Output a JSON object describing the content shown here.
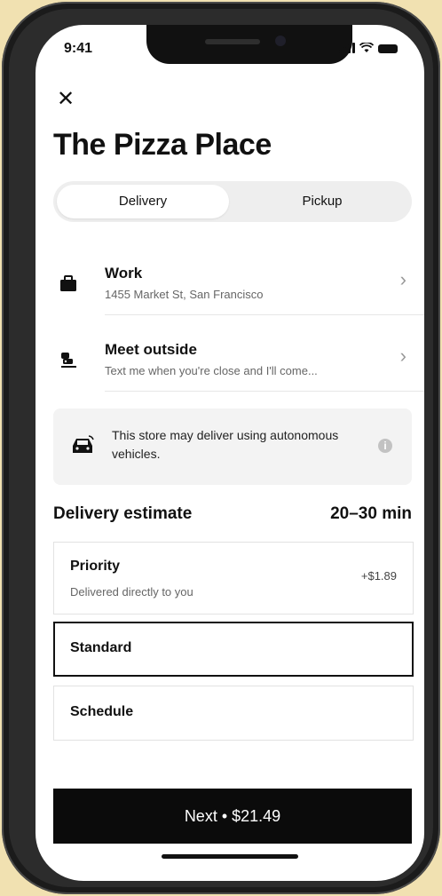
{
  "status_bar": {
    "time": "9:41"
  },
  "header": {
    "title": "The Pizza Place"
  },
  "mode_toggle": {
    "delivery_label": "Delivery",
    "pickup_label": "Pickup",
    "selected": "Delivery"
  },
  "address": {
    "title": "Work",
    "subtitle": "1455 Market St, San Francisco"
  },
  "dropoff": {
    "title": "Meet outside",
    "subtitle": "Text me when you're close and I'll come..."
  },
  "notice": {
    "text": "This store may deliver using autonomous vehicles."
  },
  "estimate": {
    "label": "Delivery estimate",
    "value": "20–30 min"
  },
  "options": [
    {
      "title": "Priority",
      "subtitle": "Delivered directly to you",
      "price": "+$1.89"
    },
    {
      "title": "Standard",
      "selected": true
    },
    {
      "title": "Schedule"
    }
  ],
  "cta": {
    "label": "Next • $21.49"
  },
  "icons": {
    "close": "close-icon",
    "address": "briefcase-icon",
    "dropoff": "person-car-icon",
    "notice": "car-icon",
    "info": "info-icon",
    "chevron": "chevron-right-icon"
  },
  "colors": {
    "primary": "#000000",
    "background": "#ffffff",
    "muted": "#f3f3f3"
  }
}
